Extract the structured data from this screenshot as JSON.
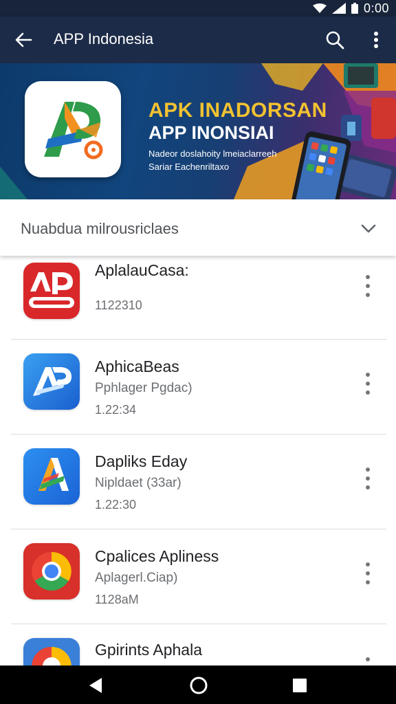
{
  "status_bar": {
    "time": "0:00",
    "icons": [
      "wifi-icon",
      "signal-icon",
      "battery-icon"
    ]
  },
  "app_bar": {
    "title": "APP Indonesia",
    "icons": [
      "back-arrow-icon",
      "search-icon",
      "more-vert-icon"
    ],
    "color": "#1c2b47"
  },
  "banner": {
    "heading": "APK INADORSAN",
    "subheading": "APP INONSIAI",
    "line1": "Nadeor doslahoity lmeiaclarreeh",
    "line2": "Sariar Eachenriltaxo",
    "logo_icon": "apk-logo-icon",
    "heading_color": "#f2c230"
  },
  "dropdown": {
    "selected": "Nuabdua milrousriclaes",
    "icon": "chevron-down-icon"
  },
  "apps": [
    {
      "title": "AplalauCasa:",
      "subtitle": "",
      "meta": "1122310",
      "icon": "apk-red-icon"
    },
    {
      "title": "AphicaBeas",
      "subtitle": "Pphlager Pgdac)",
      "meta": "1.22:34",
      "icon": "ap-blue-icon"
    },
    {
      "title": "Dapliks Eday",
      "subtitle": "Nipldaet (33ar)",
      "meta": "1.22:30",
      "icon": "a-triangle-icon"
    },
    {
      "title": "Cpalices Apliness",
      "subtitle": "Aplagerl.Ciap)",
      "meta": "1128aM",
      "icon": "chrome-like-icon"
    },
    {
      "title": "Gpirints Aphala",
      "subtitle": "",
      "meta": "",
      "icon": "circle-app-icon"
    }
  ],
  "nav_bar": {
    "icons": [
      "nav-back-icon",
      "nav-home-icon",
      "nav-recents-icon"
    ]
  }
}
